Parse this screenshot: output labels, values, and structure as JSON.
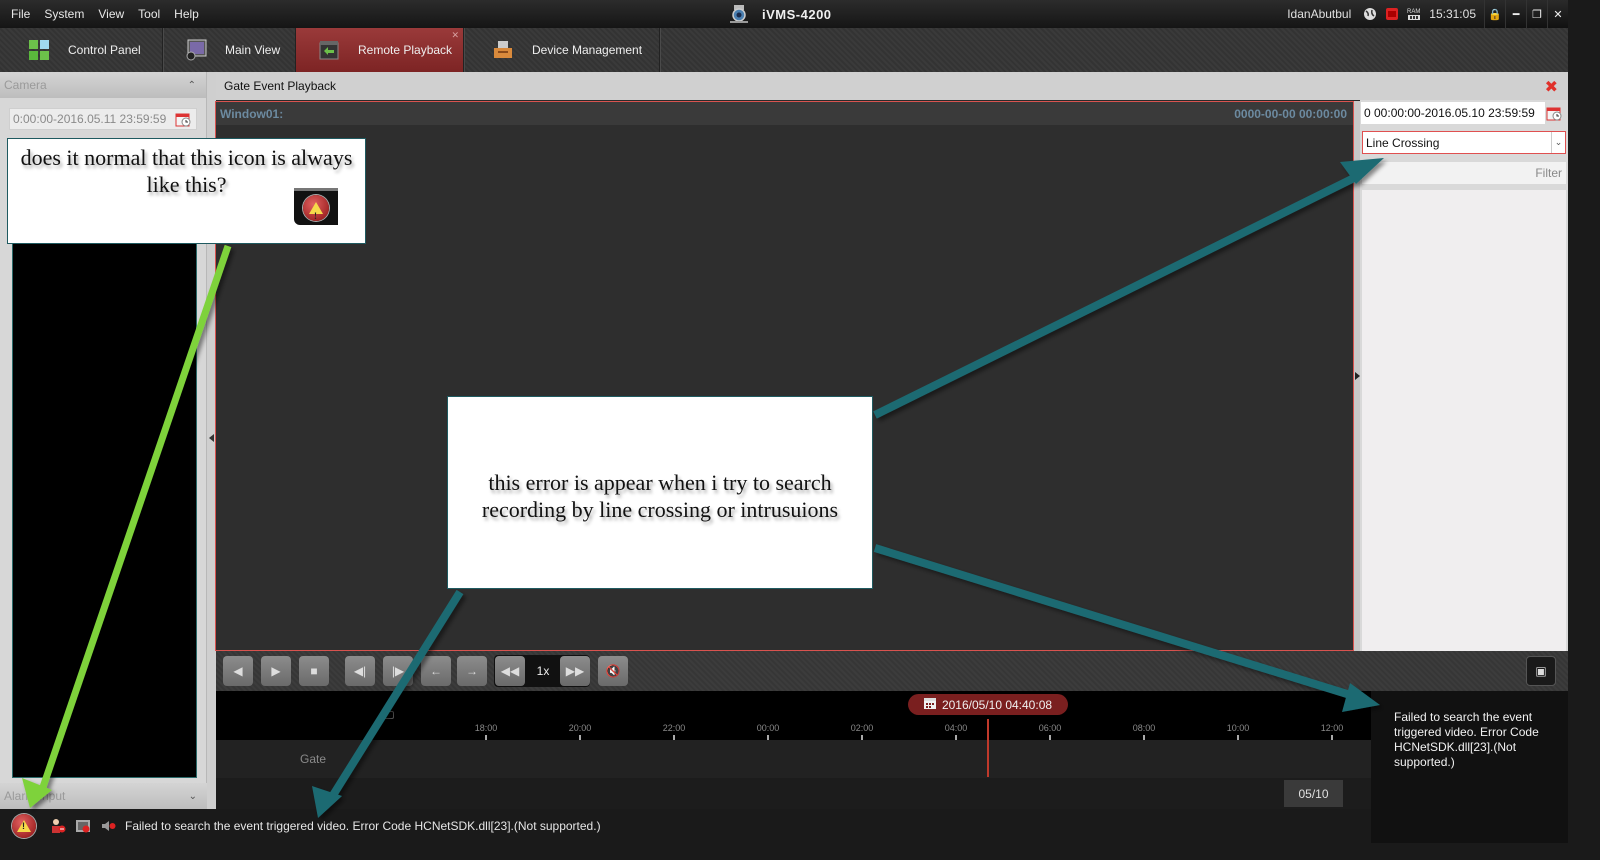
{
  "menu": [
    "File",
    "System",
    "View",
    "Tool",
    "Help"
  ],
  "app": {
    "title": "iVMS-4200",
    "user": "IdanAbutbul",
    "clock": "15:31:05",
    "cpu_label": "CPU",
    "ram_label": "RAM"
  },
  "tabs": [
    {
      "label": "Control Panel",
      "icon": "grid-icon",
      "active": false
    },
    {
      "label": "Main View",
      "icon": "camera-view-icon",
      "active": false
    },
    {
      "label": "Remote Playback",
      "icon": "playback-icon",
      "active": true
    },
    {
      "label": "Device Management",
      "icon": "device-icon",
      "active": false
    }
  ],
  "left_panel": {
    "camera_header": "Camera",
    "date_range": "0:00:00-2016.05.11 23:59:59",
    "alarm_input_header": "Alarm Input"
  },
  "content": {
    "title": "Gate Event Playback",
    "window_label": "Window01:",
    "window_time": "0000-00-00 00:00:00"
  },
  "right_panel": {
    "date_range": "0 00:00:00-2016.05.10 23:59:59",
    "event_type": "Line Crossing",
    "filter_placeholder": "Filter"
  },
  "playback": {
    "speed": "1x",
    "buttons": [
      "reverse-play",
      "play",
      "stop",
      "frame-back",
      "frame-forward",
      "previous",
      "next",
      "slow-down",
      "speed-up",
      "mute"
    ]
  },
  "timeline": {
    "current_time": "2016/05/10 04:40:08",
    "track_label": "Gate",
    "ticks": [
      "18:00",
      "20:00",
      "22:00",
      "00:00",
      "02:00",
      "04:00",
      "06:00",
      "08:00",
      "10:00",
      "12:00"
    ],
    "date_chip": "05/10"
  },
  "tooltip": {
    "text": "Failed to search the event triggered video. Error Code HCNetSDK.dll[23].(Not supported.)"
  },
  "statusbar": {
    "message": "Failed to search the event triggered video. Error Code HCNetSDK.dll[23].(Not supported.)"
  },
  "annotations": {
    "note1": "does it normal that this icon is always like this?",
    "note2": "this error is appear when i try to search recording by line crossing or intrusuions",
    "arrow_colors": {
      "green": "#7ed23a",
      "teal": "#1c6a72"
    }
  }
}
